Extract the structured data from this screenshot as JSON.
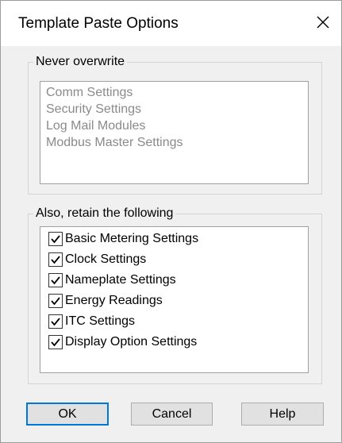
{
  "window": {
    "title": "Template Paste Options",
    "close_icon": "close-icon"
  },
  "never_overwrite": {
    "label": "Never overwrite",
    "items": [
      "Comm Settings",
      "Security Settings",
      "Log Mail Modules",
      "Modbus Master Settings"
    ]
  },
  "retain": {
    "label": "Also, retain the following",
    "items": [
      {
        "label": "Basic Metering Settings",
        "checked": true
      },
      {
        "label": "Clock Settings",
        "checked": true
      },
      {
        "label": "Nameplate Settings",
        "checked": true
      },
      {
        "label": "Energy Readings",
        "checked": true
      },
      {
        "label": "ITC Settings",
        "checked": true
      },
      {
        "label": "Display Option Settings",
        "checked": true
      }
    ]
  },
  "buttons": {
    "ok": "OK",
    "cancel": "Cancel",
    "help": "Help"
  },
  "colors": {
    "accent": "#0078d7",
    "disabled_text": "#8a8a8a"
  }
}
